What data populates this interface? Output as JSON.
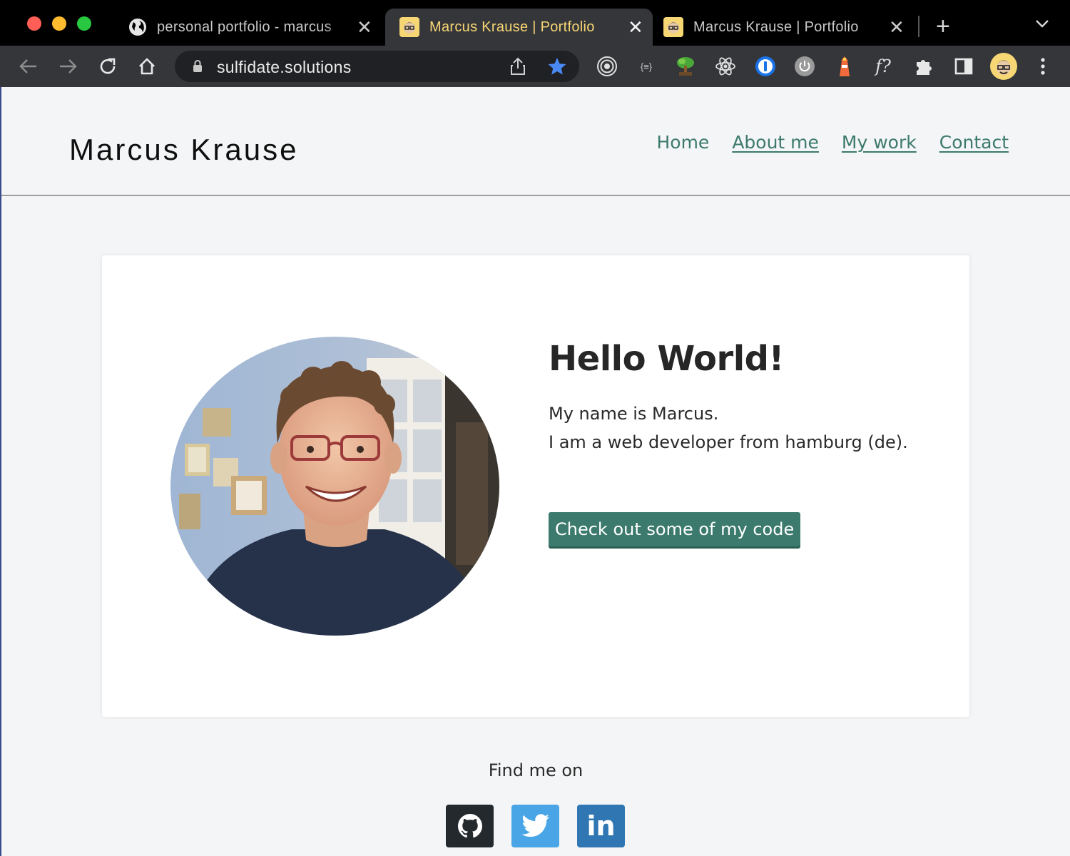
{
  "browser": {
    "tabs": [
      {
        "title": "personal portfolio - marcus",
        "favicon": "globe-icon",
        "active": false
      },
      {
        "title": "Marcus Krause | Portfolio",
        "favicon": "avatar-favicon",
        "active": true
      },
      {
        "title": "Marcus Krause | Portfolio",
        "favicon": "avatar-favicon",
        "active": false
      }
    ],
    "url": "sulfidate.solutions",
    "extensions": [
      "target-extension",
      "json-formatter",
      "bonsai-extension",
      "react-devtools",
      "1password",
      "power-extension",
      "lighthouse",
      "fonts-ninja",
      "puzzle-extensions",
      "side-panel",
      "profile-avatar",
      "more-menu"
    ],
    "fonts_ninja_label": "f?",
    "json_label": "{≡}",
    "colors": {
      "active_tab_title": "#f7d774",
      "bookmark_star": "#4a8af4"
    }
  },
  "site": {
    "name": "Marcus Krause",
    "nav": [
      {
        "label": "Home",
        "underlined": false
      },
      {
        "label": "About me",
        "underlined": true
      },
      {
        "label": "My work",
        "underlined": true
      },
      {
        "label": "Contact",
        "underlined": true
      }
    ],
    "hero": {
      "title": "Hello World!",
      "line1": "My name is Marcus.",
      "line2": "I am a web developer from hamburg (de).",
      "cta": "Check out some of my code"
    },
    "footer": {
      "find_me": "Find me on",
      "social": [
        "github-icon",
        "twitter-icon",
        "linkedin-icon"
      ],
      "linkedin_label": "in"
    },
    "colors": {
      "accent": "#3b7a6c",
      "background": "#f4f5f6",
      "card": "#ffffff"
    }
  }
}
